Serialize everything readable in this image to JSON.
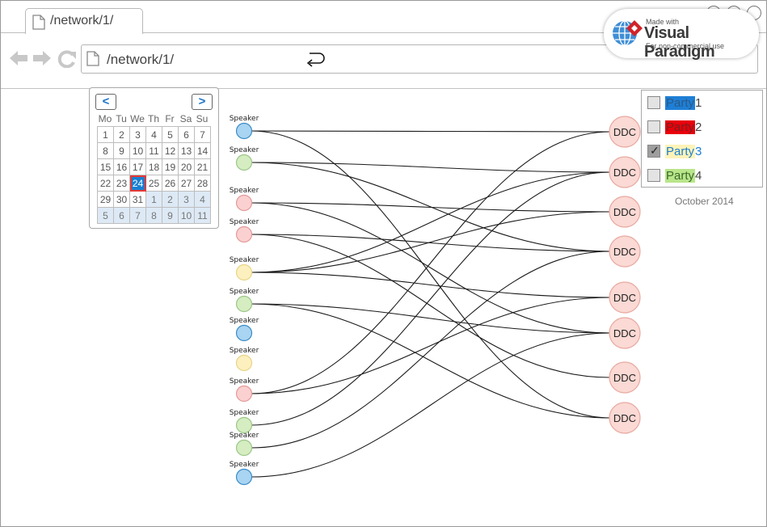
{
  "browser": {
    "tab_label": "/network/1/",
    "url": "/network/1/"
  },
  "watermark": {
    "small": "Made with",
    "brand": "Visual Paradigm",
    "sub": "For non-commercial use"
  },
  "calendar": {
    "prev": "<",
    "next": ">",
    "weekdays": [
      "Mo",
      "Tu",
      "We",
      "Th",
      "Fr",
      "Sa",
      "Su"
    ],
    "weeks": [
      [
        {
          "d": "1"
        },
        {
          "d": "2"
        },
        {
          "d": "3"
        },
        {
          "d": "4"
        },
        {
          "d": "5"
        },
        {
          "d": "6"
        },
        {
          "d": "7"
        }
      ],
      [
        {
          "d": "8"
        },
        {
          "d": "9"
        },
        {
          "d": "10"
        },
        {
          "d": "11"
        },
        {
          "d": "12"
        },
        {
          "d": "13"
        },
        {
          "d": "14"
        }
      ],
      [
        {
          "d": "15"
        },
        {
          "d": "16"
        },
        {
          "d": "17"
        },
        {
          "d": "18"
        },
        {
          "d": "19"
        },
        {
          "d": "20"
        },
        {
          "d": "21"
        }
      ],
      [
        {
          "d": "22"
        },
        {
          "d": "23"
        },
        {
          "d": "24",
          "today": true
        },
        {
          "d": "25"
        },
        {
          "d": "26"
        },
        {
          "d": "27"
        },
        {
          "d": "28"
        }
      ],
      [
        {
          "d": "29"
        },
        {
          "d": "30"
        },
        {
          "d": "31"
        },
        {
          "d": "1",
          "other": true
        },
        {
          "d": "2",
          "other": true
        },
        {
          "d": "3",
          "other": true
        },
        {
          "d": "4",
          "other": true
        }
      ],
      [
        {
          "d": "5",
          "other": true
        },
        {
          "d": "6",
          "other": true
        },
        {
          "d": "7",
          "other": true
        },
        {
          "d": "8",
          "other": true
        },
        {
          "d": "9",
          "other": true
        },
        {
          "d": "10",
          "other": true
        },
        {
          "d": "11",
          "other": true
        }
      ]
    ]
  },
  "legend": {
    "parties": [
      {
        "word": "Party",
        "num": "1",
        "checked": false,
        "bg": "#1e7fd6",
        "fg": "#2a5a8a"
      },
      {
        "word": "Party",
        "num": "2",
        "checked": false,
        "bg": "#e8000b",
        "fg": "#7a2020"
      },
      {
        "word": "Party",
        "num": "3",
        "checked": true,
        "bg": "#fff3b8",
        "fg": "#1a7fd1"
      },
      {
        "word": "Party",
        "num": "4",
        "checked": false,
        "bg": "#b9e58a",
        "fg": "#3a6a2a"
      }
    ],
    "month": "October 2014"
  },
  "network": {
    "party_colors": {
      "1": {
        "fill": "#a9d4f2",
        "stroke": "#3a8cc8"
      },
      "2": {
        "fill": "#fbd0d0",
        "stroke": "#e39a9a"
      },
      "3": {
        "fill": "#fdf0bf",
        "stroke": "#e8d488"
      },
      "4": {
        "fill": "#d5edc0",
        "stroke": "#9cc68a"
      }
    },
    "ddc_color": {
      "fill": "#fbd9d4",
      "stroke": "#e8a9a0"
    },
    "speakers": [
      {
        "label": "Speaker",
        "party": "1"
      },
      {
        "label": "Speaker",
        "party": "4"
      },
      {
        "label": "Speaker",
        "party": "2"
      },
      {
        "label": "Speaker",
        "party": "2"
      },
      {
        "label": "Speaker",
        "party": "3"
      },
      {
        "label": "Speaker",
        "party": "4"
      },
      {
        "label": "Speaker",
        "party": "1"
      },
      {
        "label": "Speaker",
        "party": "3"
      },
      {
        "label": "Speaker",
        "party": "2"
      },
      {
        "label": "Speaker",
        "party": "4"
      },
      {
        "label": "Speaker",
        "party": "4"
      },
      {
        "label": "Speaker",
        "party": "1"
      }
    ],
    "ddcs": [
      "DDC",
      "DDC",
      "DDC",
      "DDC",
      "DDC",
      "DDC",
      "DDC",
      "DDC"
    ],
    "links": [
      [
        0,
        0
      ],
      [
        0,
        7
      ],
      [
        1,
        1
      ],
      [
        1,
        3
      ],
      [
        2,
        2
      ],
      [
        2,
        5
      ],
      [
        3,
        3
      ],
      [
        3,
        6
      ],
      [
        4,
        1
      ],
      [
        4,
        2
      ],
      [
        4,
        4
      ],
      [
        5,
        5
      ],
      [
        5,
        7
      ],
      [
        8,
        0
      ],
      [
        8,
        4
      ],
      [
        9,
        1
      ],
      [
        10,
        3
      ],
      [
        11,
        5
      ]
    ]
  }
}
